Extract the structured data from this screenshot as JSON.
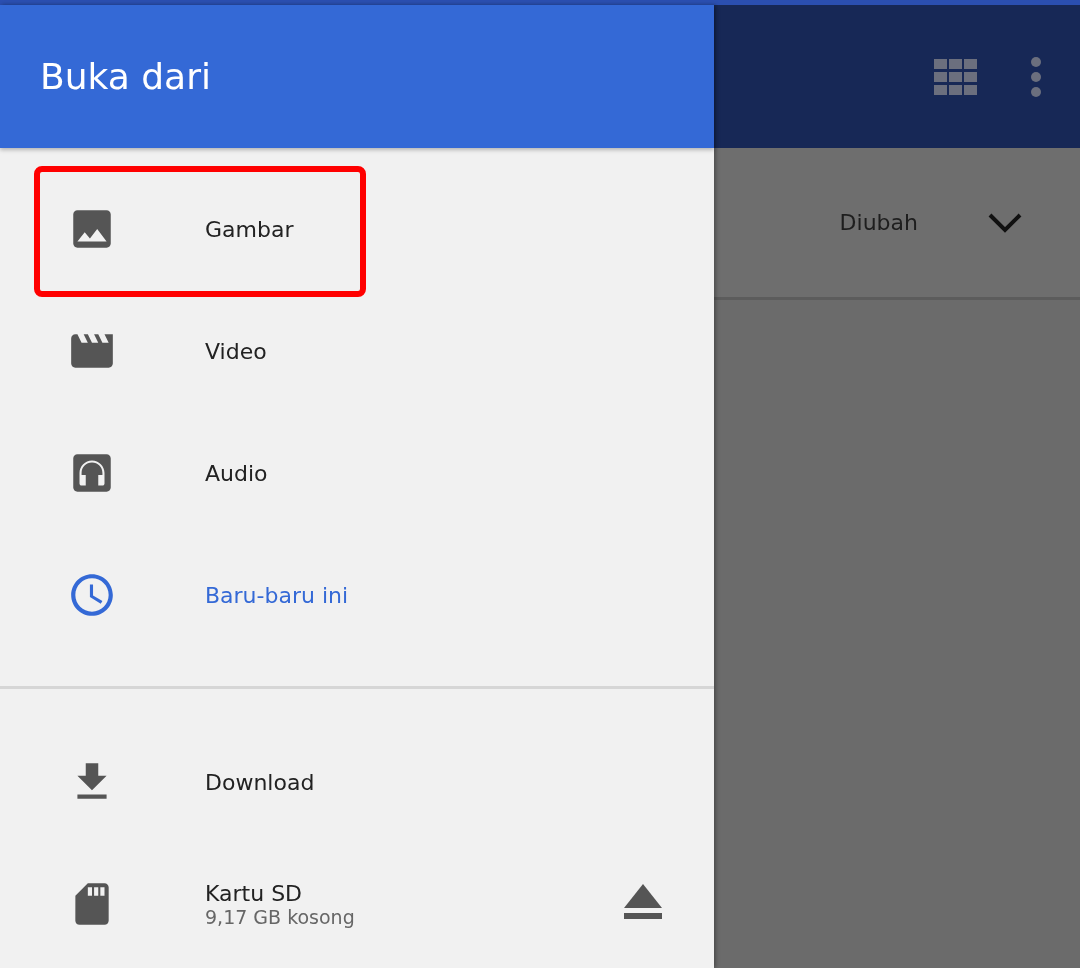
{
  "drawer": {
    "title": "Buka dari",
    "items": [
      {
        "kind": "image",
        "label": "Gambar",
        "selected": false,
        "highlighted": true
      },
      {
        "kind": "video",
        "label": "Video",
        "selected": false,
        "highlighted": false
      },
      {
        "kind": "audio",
        "label": "Audio",
        "selected": false,
        "highlighted": false
      },
      {
        "kind": "recent",
        "label": "Baru-baru ini",
        "selected": true,
        "highlighted": false
      }
    ],
    "roots": [
      {
        "kind": "download",
        "label": "Download",
        "selected": false
      },
      {
        "kind": "sdcard",
        "label": "Kartu SD",
        "subtitle": "9,17 GB kosong",
        "selected": false,
        "ejectable": true
      }
    ]
  },
  "sort": {
    "label": "Diubah"
  }
}
